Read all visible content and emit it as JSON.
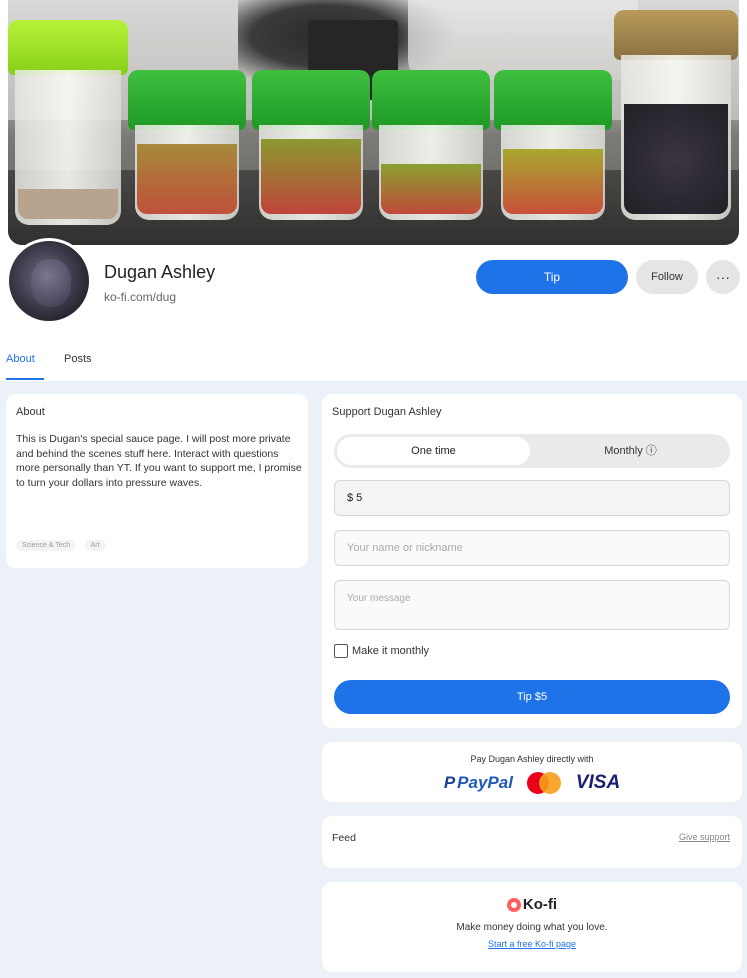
{
  "profile": {
    "name": "Dugan Ashley",
    "handle": "ko-fi.com/dug",
    "tip_label": "Tip",
    "follow_label": "Follow",
    "more_label": "···"
  },
  "tabs": [
    {
      "label": "About",
      "active": true
    },
    {
      "label": "Posts",
      "active": false
    }
  ],
  "about": {
    "title": "About",
    "text": "This is Dugan's special sauce page. I will post more private and behind the scenes stuff here. Interact with questions more personally than YT. If you want to support me, I promise to turn your dollars into pressure waves.",
    "tags": [
      "Science & Tech",
      "Art"
    ]
  },
  "support": {
    "title": "Support Dugan Ashley",
    "one_time_label": "One time",
    "monthly_label": "Monthly ⓘ",
    "amount_value": "$ 5",
    "name_placeholder": "Your name or nickname",
    "message_placeholder": "Your message",
    "make_monthly_label": "Make it monthly",
    "tip_button_label": "Tip $5"
  },
  "payment": {
    "text": "Pay Dugan Ashley directly with",
    "paypal": "PayPal",
    "visa": "VISA"
  },
  "feed": {
    "title": "Feed",
    "link": "Give support"
  },
  "kofi": {
    "logo": "Ko-fi",
    "tagline": "Make money doing what you love.",
    "link": "Start a free Ko-fi page"
  },
  "colors": {
    "accent": "#1e73e8",
    "page_bg": "#ecf1f7"
  }
}
